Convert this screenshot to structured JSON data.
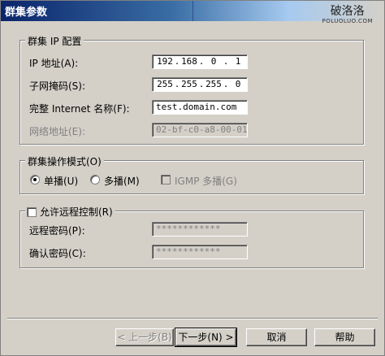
{
  "window": {
    "title": "群集参数",
    "watermark": "破洛洛",
    "watermark_sub": "POLUOLUO.COM"
  },
  "ip_group": {
    "legend": "群集 IP 配置",
    "ip_label": "IP 地址(A):",
    "ip_segments": [
      "192",
      "168",
      "0",
      "1"
    ],
    "mask_label": "子网掩码(S):",
    "mask_segments": [
      "255",
      "255",
      "255",
      "0"
    ],
    "fqdn_label": "完整 Internet 名称(F):",
    "fqdn_value": "test.domain.com",
    "netaddr_label": "网络地址(E):",
    "netaddr_value": "02-bf-c0-a8-00-01"
  },
  "mode_group": {
    "legend": "群集操作模式(O)",
    "unicast_label": "单播(U)",
    "unicast_selected": true,
    "multicast_label": "多播(M)",
    "multicast_selected": false,
    "igmp_label": "IGMP 多播(G)",
    "igmp_checked": false
  },
  "remote_group": {
    "legend": "允许远程控制(R)",
    "enabled": false,
    "password_label": "远程密码(P):",
    "password_value": "************",
    "confirm_label": "确认密码(C):",
    "confirm_value": "************"
  },
  "buttons": {
    "back": "< 上一步(B)",
    "next": "下一步(N) >",
    "cancel": "取消",
    "help": "帮助"
  }
}
